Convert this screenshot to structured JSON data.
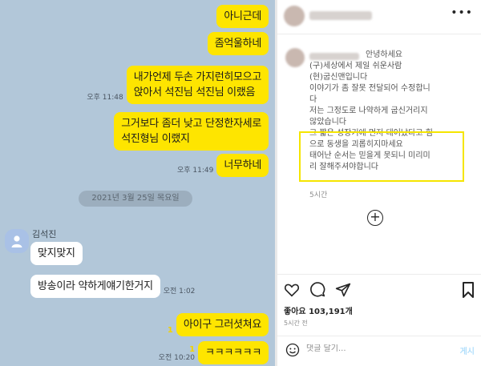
{
  "chat": {
    "messages_top": [
      {
        "text": "아니근데"
      },
      {
        "text": "좀억울하네"
      },
      {
        "lines": [
          "내가언제 두손 가지런히모으고",
          "앉아서 석진님 석진님 이랬음"
        ],
        "time": "오후 11:48"
      },
      {
        "lines": [
          "그거보다 좀더 낮고 단정한자세로",
          "석진형님 이랬지"
        ]
      },
      {
        "text": "너무하네",
        "time": "오후 11:49"
      }
    ],
    "date_divider": "2021년 3월 25일 목요일",
    "sender_name": "김석진",
    "received": [
      {
        "text": "맞지맞지"
      },
      {
        "text": "방송이라 약하게얘기한거지",
        "time": "오전 1:02"
      }
    ],
    "sent_after": [
      {
        "text": "아이구 그러셧쳐요",
        "unread": "1"
      },
      {
        "text": "ㅋㅋㅋㅋㅋㅋ",
        "time": "오전 10:20",
        "unread": "1"
      }
    ]
  },
  "instagram": {
    "comment_greeting": "안녕하세요",
    "comment_lines": [
      "(구)세상에서 제일 쉬운사람",
      "(현)굽신맨입니다",
      "이야기가 좀 잘못 전달되어 수정합니",
      "다",
      "저는 그정도로 나약하게 굽신거리지",
      "않았습니다",
      "그 짧은 성장기에 먼저 태어났다고 힘",
      "으로 동생을 괴롭히지마세요",
      "태어난 순서는 믿을게 못되니 미리미",
      "리 잘해주셔야합니다"
    ],
    "comment_time": "5시간",
    "likes": "좋아요 103,191개",
    "post_time": "5시간 전",
    "comment_placeholder": "댓글 달기...",
    "post_button": "게시",
    "colors": {
      "highlight": "#f5e500",
      "kakao_yellow": "#fee500",
      "chat_bg": "#b2c7d9"
    },
    "icons": [
      "more-icon",
      "heart-icon",
      "comment-icon",
      "share-icon",
      "bookmark-icon",
      "plus-circle-icon",
      "emoji-icon"
    ]
  }
}
